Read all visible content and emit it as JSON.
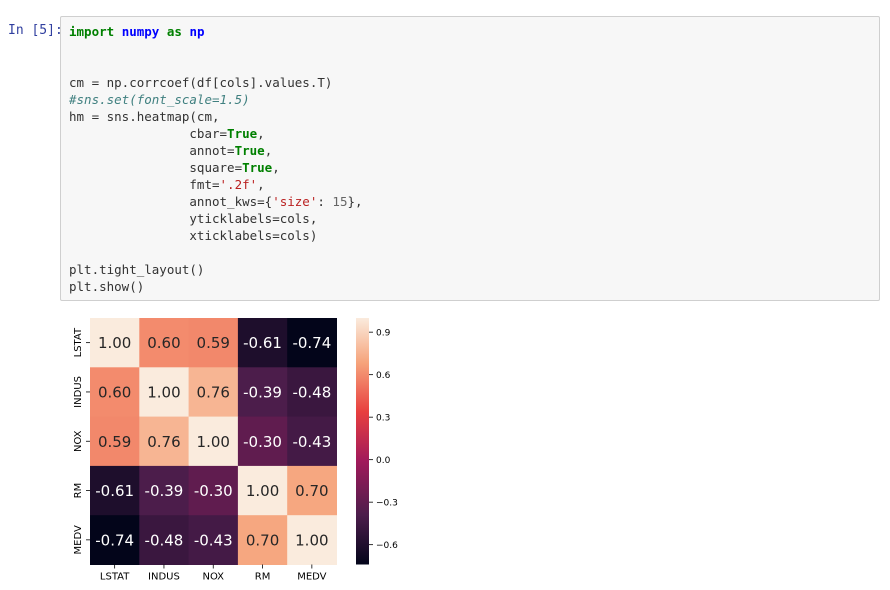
{
  "notebook": {
    "prompt": "In [5]:",
    "code_lines": [
      [
        {
          "t": "import",
          "c": "kw"
        },
        {
          "t": " ",
          "c": ""
        },
        {
          "t": "numpy",
          "c": "mod"
        },
        {
          "t": " ",
          "c": ""
        },
        {
          "t": "as",
          "c": "kw"
        },
        {
          "t": " ",
          "c": ""
        },
        {
          "t": "np",
          "c": "mod"
        }
      ],
      [],
      [],
      [
        {
          "t": "cm = np.corrcoef(df[cols].values.T)",
          "c": ""
        }
      ],
      [
        {
          "t": "#sns.set(font_scale=1.5)",
          "c": "cm"
        }
      ],
      [
        {
          "t": "hm = sns.heatmap(cm,",
          "c": ""
        }
      ],
      [
        {
          "t": "                cbar=",
          "c": ""
        },
        {
          "t": "True",
          "c": "kw"
        },
        {
          "t": ",",
          "c": ""
        }
      ],
      [
        {
          "t": "                annot=",
          "c": ""
        },
        {
          "t": "True",
          "c": "kw"
        },
        {
          "t": ",",
          "c": ""
        }
      ],
      [
        {
          "t": "                square=",
          "c": ""
        },
        {
          "t": "True",
          "c": "kw"
        },
        {
          "t": ",",
          "c": ""
        }
      ],
      [
        {
          "t": "                fmt=",
          "c": ""
        },
        {
          "t": "'.2f'",
          "c": "str"
        },
        {
          "t": ",",
          "c": ""
        }
      ],
      [
        {
          "t": "                annot_kws={",
          "c": ""
        },
        {
          "t": "'size'",
          "c": "str"
        },
        {
          "t": ": ",
          "c": ""
        },
        {
          "t": "15",
          "c": "num"
        },
        {
          "t": "},",
          "c": ""
        }
      ],
      [
        {
          "t": "                yticklabels=cols,",
          "c": ""
        }
      ],
      [
        {
          "t": "                xticklabels=cols)",
          "c": ""
        }
      ],
      [],
      [
        {
          "t": "plt.tight_layout()",
          "c": ""
        }
      ],
      [
        {
          "t": "plt.show()",
          "c": ""
        }
      ]
    ]
  },
  "chart_data": {
    "type": "heatmap",
    "labels": [
      "LSTAT",
      "INDUS",
      "NOX",
      "RM",
      "MEDV"
    ],
    "values": [
      [
        1.0,
        0.6,
        0.59,
        -0.61,
        -0.74
      ],
      [
        0.6,
        1.0,
        0.76,
        -0.39,
        -0.48
      ],
      [
        0.59,
        0.76,
        1.0,
        -0.3,
        -0.43
      ],
      [
        -0.61,
        -0.39,
        -0.3,
        1.0,
        0.7
      ],
      [
        -0.74,
        -0.48,
        -0.43,
        0.7,
        1.0
      ]
    ],
    "annotations": [
      [
        "1.00",
        "0.60",
        "0.59",
        "-0.61",
        "-0.74"
      ],
      [
        "0.60",
        "1.00",
        "0.76",
        "-0.39",
        "-0.48"
      ],
      [
        "0.59",
        "0.76",
        "1.00",
        "-0.30",
        "-0.43"
      ],
      [
        "-0.61",
        "-0.39",
        "-0.30",
        "1.00",
        "0.70"
      ],
      [
        "-0.74",
        "-0.48",
        "-0.43",
        "0.70",
        "1.00"
      ]
    ],
    "colorbar": {
      "range": [
        -0.74,
        1.0
      ],
      "ticks": [
        0.9,
        0.6,
        0.3,
        0.0,
        -0.3,
        -0.6
      ],
      "tick_labels": [
        "0.9",
        "0.6",
        "0.3",
        "0.0",
        "−0.3",
        "−0.6"
      ],
      "colormap": "rocket"
    },
    "title": "",
    "xlabel": "",
    "ylabel": ""
  }
}
